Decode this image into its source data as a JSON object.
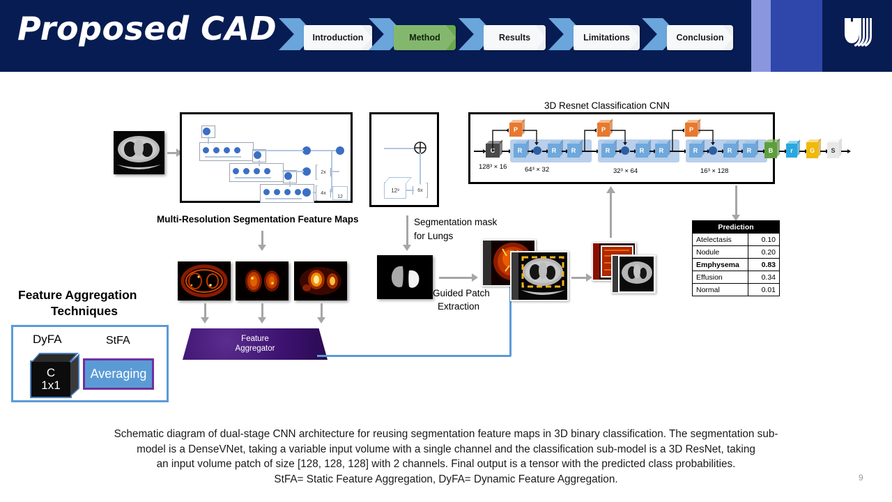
{
  "header": {
    "title": "Proposed CAD",
    "logo_icon": "duke-shield-logo",
    "nav": [
      {
        "label": "Introduction",
        "active": false
      },
      {
        "label": "Method",
        "active": true
      },
      {
        "label": "Results",
        "active": false
      },
      {
        "label": "Limitations",
        "active": false
      },
      {
        "label": "Conclusion",
        "active": false
      }
    ]
  },
  "diagram": {
    "segmentation_panel_label": "Multi-Resolution Segmentation Feature Maps",
    "segmentation_mask_label": "Segmentation mask\nfor Lungs",
    "segmentation_mask_label_l1": "Segmentation mask",
    "segmentation_mask_label_l2": "for Lungs",
    "guided_patch_label_l1": "Guided Patch",
    "guided_patch_label_l2": "Extraction",
    "resnet_title": "3D Resnet Classification CNN",
    "densevnet": {
      "upsample_2x": "2x",
      "upsample_4x": "4x",
      "channels_tag": "12"
    },
    "segmask_block": {
      "volume_tag": "12³",
      "upsample": "6x",
      "sum_icon": "plus-circle-icon"
    },
    "resnet": {
      "stage_labels": [
        "128³ × 16",
        "64³ × 32",
        "32³ × 64",
        "16³ × 128"
      ],
      "first_block": "C",
      "pool_label": "P",
      "res_label": "R",
      "tail_blocks": [
        {
          "label": "B",
          "color": "#5e9e3e"
        },
        {
          "label": "r",
          "color": "#29a8e0"
        },
        {
          "label": "G",
          "color": "#f0b90b"
        },
        {
          "label": "S",
          "color": "#e8e8e8"
        }
      ]
    },
    "feature_aggregator_l1": "Feature",
    "feature_aggregator_l2": "Aggregator"
  },
  "prediction_table": {
    "header": "Prediction",
    "rows": [
      {
        "label": "Atelectasis",
        "value": "0.10",
        "highlight": false
      },
      {
        "label": "Nodule",
        "value": "0.20",
        "highlight": false
      },
      {
        "label": "Emphysema",
        "value": "0.83",
        "highlight": true
      },
      {
        "label": "Effusion",
        "value": "0.34",
        "highlight": false
      },
      {
        "label": "Normal",
        "value": "0.01",
        "highlight": false
      }
    ]
  },
  "feature_aggregation": {
    "title_l1": "Feature Aggregation",
    "title_l2": "Techniques",
    "dyfa_label": "DyFA",
    "stfa_label": "StFA",
    "dyfa_cube_l1": "C",
    "dyfa_cube_l2": "1x1",
    "stfa_box_label": "Averaging"
  },
  "caption": {
    "line1": "Schematic diagram of dual-stage CNN architecture for reusing segmentation feature maps in 3D binary classification. The segmentation sub-",
    "line2": "model is a DenseVNet, taking a variable input volume with a single channel and the classification sub-model is a 3D ResNet, taking",
    "line3": "an input volume patch of size [128, 128, 128] with 2 channels. Final output is a tensor with the predicted class probabilities.",
    "line4": "StFA= Static Feature Aggregation, DyFA= Dynamic Feature Aggregation."
  },
  "page_number": "9",
  "colors": {
    "header_bg": "#071c52",
    "nav_chevron": "#6aa5db",
    "nav_active": "#6aa84f",
    "accent_blue": "#5b9bd5",
    "aggregator_purple": "#3d1270",
    "stfa_border": "#7030a0"
  }
}
